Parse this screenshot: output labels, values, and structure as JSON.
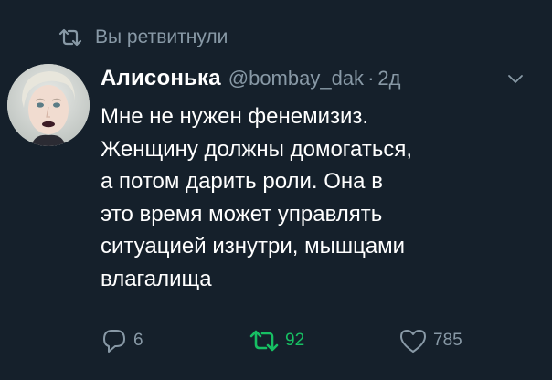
{
  "retweet_context": {
    "text": "Вы ретвитнули",
    "icon": "retweet-icon"
  },
  "author": {
    "display_name": "Алисонька",
    "handle": "@bombay_dak",
    "separator": "·",
    "time": "2д"
  },
  "tweet": {
    "lines": [
      "Мне не нужен фенемизиз.",
      "Женщину должны домогаться,",
      "а потом дарить роли. Она в",
      "это время может управлять",
      "ситуацией изнутри, мышцами",
      "влагалища"
    ]
  },
  "actions": {
    "reply_count": "6",
    "retweet_count": "92",
    "like_count": "785"
  },
  "colors": {
    "background": "#15202b",
    "text": "#ffffff",
    "secondary": "#8899a6",
    "retweeted": "#17bf63"
  }
}
